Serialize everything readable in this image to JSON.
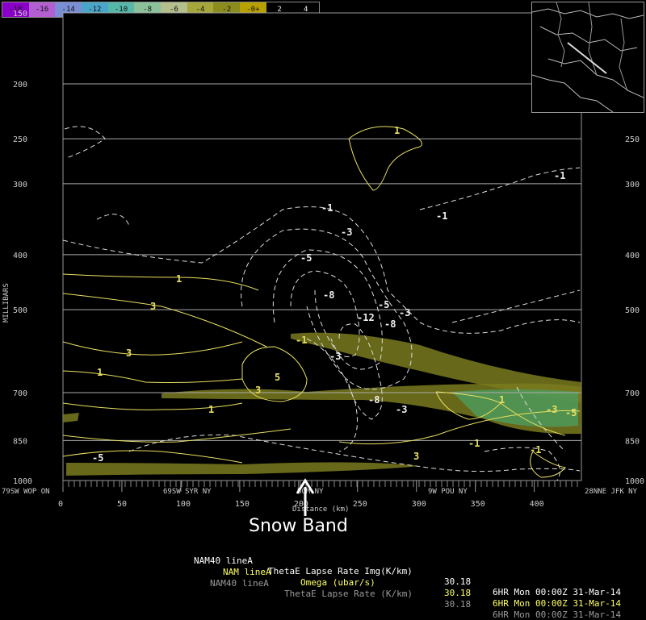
{
  "colorbar": {
    "labels": [
      "-18",
      "-16",
      "-14",
      "-12",
      "-10",
      "-8",
      "-6",
      "-4",
      "-2",
      "-0+",
      "2",
      "4"
    ],
    "colors": [
      "#8b00c8",
      "#b35ed2",
      "#7a8ed6",
      "#4aa6c8",
      "#55b8a8",
      "#8cc29a",
      "#b3bf8c",
      "#a6a63a",
      "#8c8c1e",
      "#b8a000",
      "#000000",
      "#000000"
    ]
  },
  "axis": {
    "ylabel": "MILLIBARS",
    "xlabel": "Distance (km)",
    "y_ticks": [
      "150",
      "200",
      "250",
      "300",
      "400",
      "500",
      "700",
      "850",
      "1000"
    ],
    "x_ticks": [
      "0",
      "50",
      "100",
      "150",
      "200",
      "250",
      "300",
      "350",
      "400"
    ],
    "stations": [
      "79SW WOP ON",
      "69SW SYR NY",
      "BGM NY",
      "9W POU NY",
      "28NNE JFK NY"
    ]
  },
  "annotation": {
    "text": "Snow Band"
  },
  "status_lines": [
    {
      "model": "NAM40 lineA",
      "field": "ThetaE Lapse Rate Img(K/km)",
      "val": "30.18",
      "time": "6HR Mon 00:00Z 31-Mar-14",
      "color": "#ffffff"
    },
    {
      "model": "NAM lineA",
      "field": "Omega (ubar/s)",
      "val": "30.18",
      "time": "6HR Mon 00:00Z 31-Mar-14",
      "color": "#ffff66"
    },
    {
      "model": "NAM40 lineA",
      "field": "ThetaE Lapse Rate (K/km)",
      "val": "30.18",
      "time": "6HR Mon 00:00Z 31-Mar-14",
      "color": "#9a9a9a"
    }
  ],
  "chart_data": {
    "type": "contour",
    "title": "",
    "xlabel": "Distance (km)",
    "ylabel": "MILLIBARS",
    "xlim": [
      0,
      440
    ],
    "ylim": [
      1000,
      150
    ],
    "y_log": true,
    "grid": true,
    "pressure_levels": [
      150,
      200,
      250,
      300,
      400,
      500,
      700,
      850,
      1000
    ],
    "omega_contour_labels": [
      "-1",
      "-3",
      "-5",
      "-8",
      "-12",
      "-3",
      "-8",
      "-5",
      "-3",
      "-1",
      "-1",
      "-5",
      "-3",
      "-1"
    ],
    "thetae_contour_labels": [
      "1",
      "3",
      "5",
      "3",
      "1",
      "3",
      "1",
      "1",
      "1",
      "-1",
      "-3",
      "-5",
      "-1",
      "-1",
      "3"
    ],
    "fill_field": "ThetaE Lapse Rate Img(K/km)",
    "contour_fields": [
      "Omega (ubar/s)",
      "ThetaE Lapse Rate (K/km)"
    ]
  }
}
